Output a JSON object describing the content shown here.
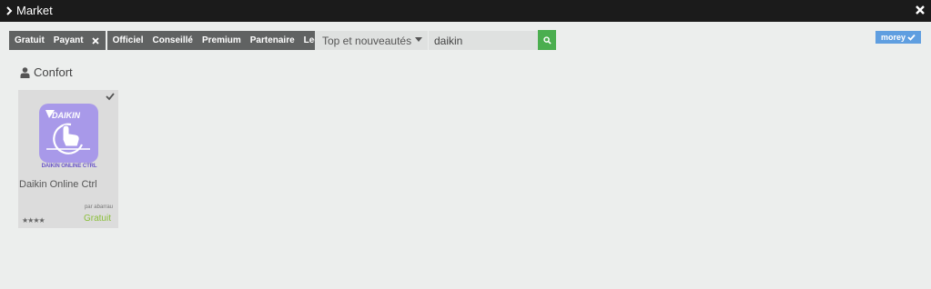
{
  "window": {
    "title": "Market"
  },
  "filters": {
    "price": [
      "Gratuit",
      "Payant"
    ],
    "certification": [
      "Officiel",
      "Conseillé",
      "Premium",
      "Partenaire",
      "Legacy"
    ]
  },
  "sort": {
    "selected": "Top et nouveautés"
  },
  "search": {
    "value": "daikin"
  },
  "user": {
    "name": "morey"
  },
  "category": {
    "label": "Confort"
  },
  "plugins": [
    {
      "logo_text": "DAIKIN",
      "logo_caption": "DAIKIN ONLINE CTRL",
      "name": "Daikin Online Ctrl",
      "author": "par abarrau",
      "rating": "★★★★",
      "price": "Gratuit"
    }
  ],
  "colors": {
    "titlebar": "#1b1b1b",
    "filter_bg": "#606262",
    "search_button": "#4bae4f",
    "user_badge": "#5f9ee0",
    "logo_bg": "#a899e9",
    "price_green": "#8bbf3a"
  },
  "icons": {
    "window": "chevron-right-icon",
    "close": "close-icon",
    "clear_filter": "close-icon",
    "dropdown": "caret-down-icon",
    "search": "search-icon",
    "user_check": "check-icon",
    "category": "user-icon",
    "installed": "check-icon"
  }
}
